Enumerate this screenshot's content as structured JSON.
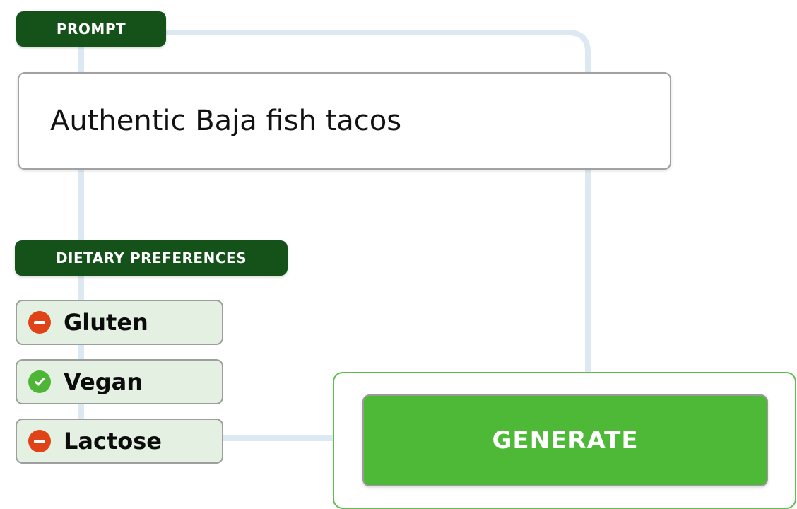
{
  "colors": {
    "label_background": "#15521a",
    "connector": "#dde9f2",
    "chip_background": "#e4f1e2",
    "excluded_icon": "#df4317",
    "included_icon": "#4db636",
    "generate_button": "#4eb936",
    "generate_panel_border": "#62b94f"
  },
  "prompt": {
    "label": "PROMPT",
    "value": "Authentic Baja fish tacos"
  },
  "dietary": {
    "label": "DIETARY PREFERENCES",
    "items": [
      {
        "label": "Gluten",
        "state": "excluded",
        "icon": "minus-circle-icon"
      },
      {
        "label": "Vegan",
        "state": "included",
        "icon": "check-circle-icon"
      },
      {
        "label": "Lactose",
        "state": "excluded",
        "icon": "minus-circle-icon"
      }
    ]
  },
  "generate": {
    "label": "GENERATE"
  }
}
